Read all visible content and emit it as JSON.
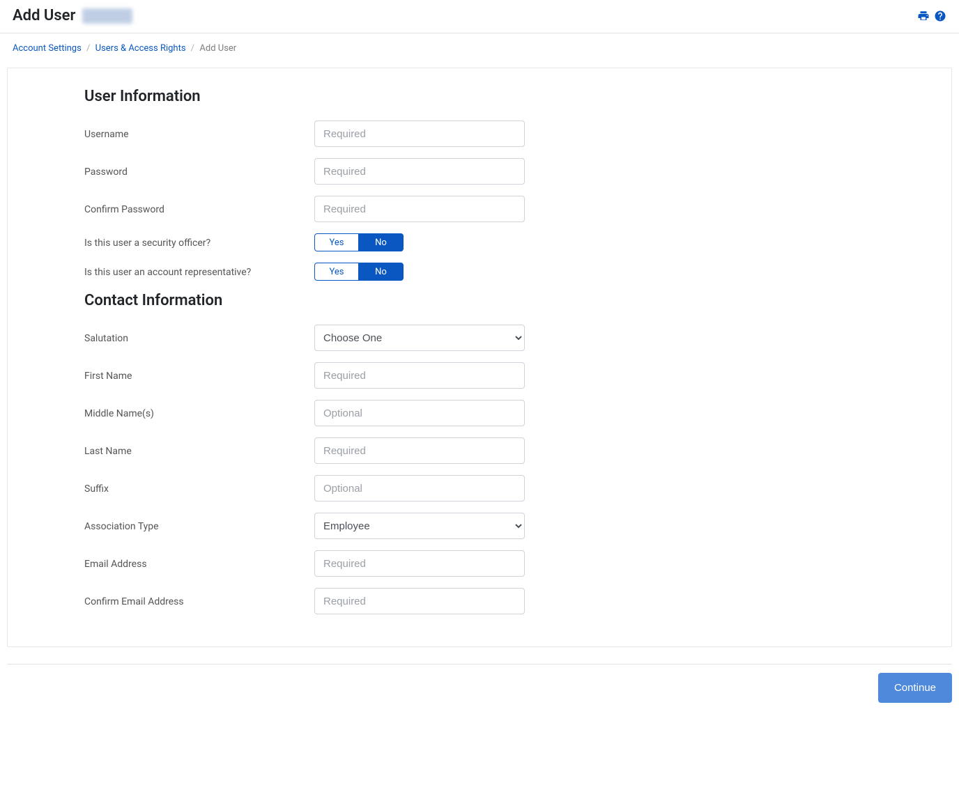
{
  "header": {
    "title": "Add User"
  },
  "breadcrumb": {
    "item1": "Account Settings",
    "item2": "Users & Access Rights",
    "current": "Add User"
  },
  "sections": {
    "user_info_title": "User Information",
    "contact_info_title": "Contact Information"
  },
  "fields": {
    "username_label": "Username",
    "username_placeholder": "Required",
    "password_label": "Password",
    "password_placeholder": "Required",
    "confirm_password_label": "Confirm Password",
    "confirm_password_placeholder": "Required",
    "security_officer_label": "Is this user a security officer?",
    "account_rep_label": "Is this user an account representative?",
    "salutation_label": "Salutation",
    "salutation_selected": "Choose One",
    "first_name_label": "First Name",
    "first_name_placeholder": "Required",
    "middle_name_label": "Middle Name(s)",
    "middle_name_placeholder": "Optional",
    "last_name_label": "Last Name",
    "last_name_placeholder": "Required",
    "suffix_label": "Suffix",
    "suffix_placeholder": "Optional",
    "association_type_label": "Association Type",
    "association_type_selected": "Employee",
    "email_label": "Email Address",
    "email_placeholder": "Required",
    "confirm_email_label": "Confirm Email Address",
    "confirm_email_placeholder": "Required"
  },
  "toggle": {
    "yes": "Yes",
    "no": "No"
  },
  "actions": {
    "continue": "Continue"
  }
}
